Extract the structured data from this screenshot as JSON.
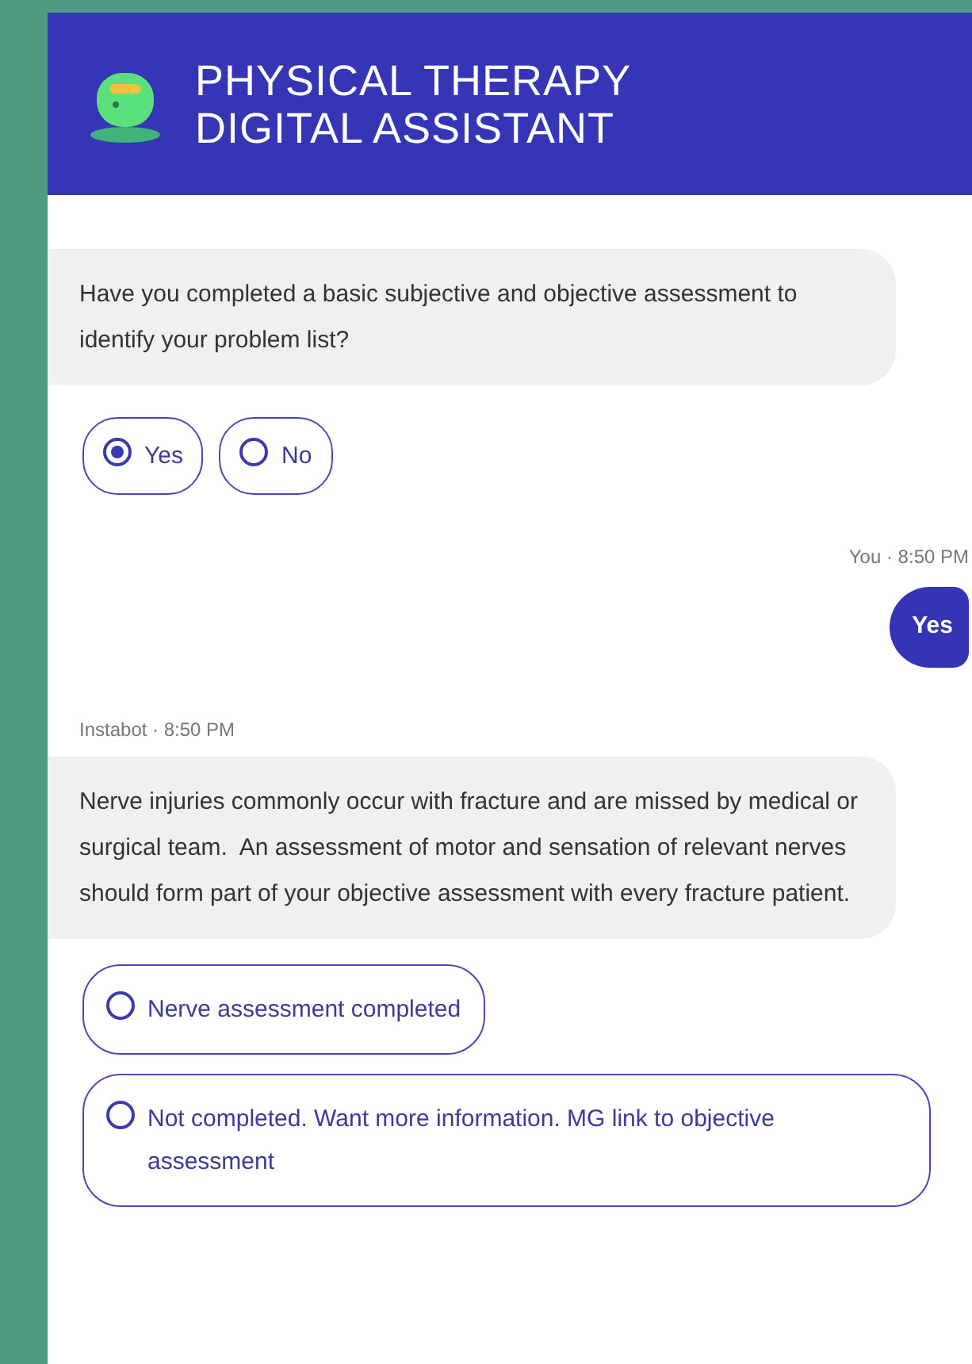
{
  "header": {
    "title_lines": [
      "PHYSICAL THERAPY",
      "DIGITAL ASSISTANT"
    ]
  },
  "messages": [
    {
      "kind": "bot",
      "text": "Have you completed a basic subjective and objective assessment to identify your problem list?",
      "options": [
        {
          "label": "Yes",
          "selected": true
        },
        {
          "label": "No",
          "selected": false
        }
      ]
    },
    {
      "kind": "user",
      "meta": "You · 8:50 PM",
      "text": "Yes"
    },
    {
      "kind": "bot",
      "meta": "Instabot · 8:50 PM",
      "text": "Nerve injuries commonly occur with fracture and are missed by medical or surgical team.  An assessment of motor and sensation of relevant nerves should form part of your objective assessment with every fracture patient.",
      "options": [
        {
          "label": "Nerve assessment completed",
          "selected": false
        },
        {
          "label": "Not completed. Want more information. MG link to objective assessment",
          "selected": false
        }
      ]
    }
  ]
}
